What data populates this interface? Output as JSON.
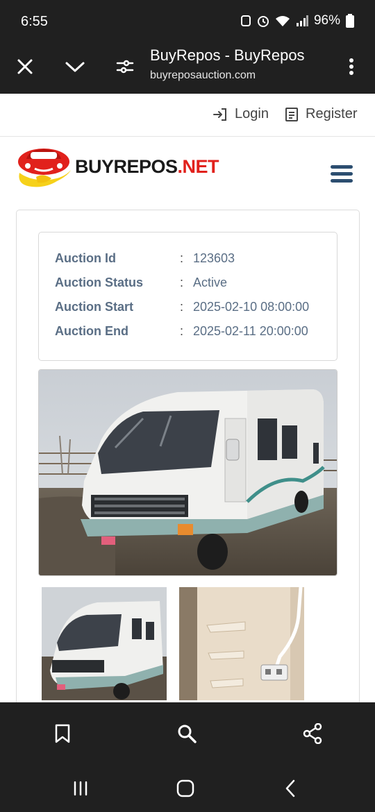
{
  "status_bar": {
    "time": "6:55",
    "battery": "96%"
  },
  "browser": {
    "title": "BuyRepos - BuyRepos",
    "url": "buyreposauction.com",
    "close_icon": "close-icon",
    "tabs_icon": "chevron-down-icon",
    "settings_icon": "page-settings-icon",
    "menu_icon": "more-vert-icon"
  },
  "nav": {
    "login_label": "Login",
    "register_label": "Register"
  },
  "logo": {
    "text_main": "BUYREPOS",
    "text_tld": ".NET",
    "brand_color": "#e1211c"
  },
  "auction": {
    "rows": [
      {
        "label": "Auction Id",
        "value": "123603"
      },
      {
        "label": "Auction Status",
        "value": "Active"
      },
      {
        "label": "Auction Start",
        "value": "2025-02-10 08:00:00"
      },
      {
        "label": "Auction End",
        "value": "2025-02-11 20:00:00"
      }
    ],
    "separator": ":"
  },
  "bottom_bar": {
    "icons": [
      "bookmark-icon",
      "search-icon",
      "share-icon"
    ]
  }
}
